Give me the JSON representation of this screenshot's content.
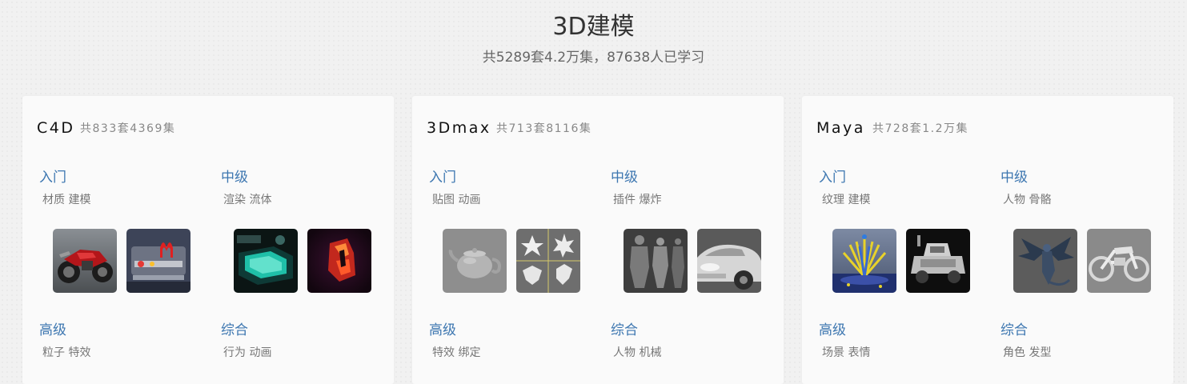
{
  "header": {
    "title": "3D建模",
    "subtitle": "共5289套4.2万集，87638人已学习"
  },
  "cards": [
    {
      "title": "C4D",
      "count": "共833套4369集",
      "levels": [
        {
          "label": "入门",
          "tags": "材质 建模"
        },
        {
          "label": "中级",
          "tags": "渲染 流体"
        },
        {
          "label": "高级",
          "tags": "粒子 特效"
        },
        {
          "label": "综合",
          "tags": "行为 动画"
        }
      ],
      "thumbs": [
        "motorcycle-render-thumbnail",
        "mcdonalds-sign-render-thumbnail",
        "teal-glow-machine-thumbnail",
        "red-crystal-object-thumbnail"
      ]
    },
    {
      "title": "3Dmax",
      "count": "共713套8116集",
      "levels": [
        {
          "label": "入门",
          "tags": "贴图 动画"
        },
        {
          "label": "中级",
          "tags": "插件 爆炸"
        },
        {
          "label": "高级",
          "tags": "特效 绑定"
        },
        {
          "label": "综合",
          "tags": "人物 机械"
        }
      ],
      "thumbs": [
        "teapot-model-thumbnail",
        "lily-flower-viewports-thumbnail",
        "character-sculpt-thumbnail",
        "car-clay-render-thumbnail"
      ]
    },
    {
      "title": "Maya",
      "count": "共728套1.2万集",
      "levels": [
        {
          "label": "入门",
          "tags": "纹理 建模"
        },
        {
          "label": "中级",
          "tags": "人物 骨骼"
        },
        {
          "label": "高级",
          "tags": "场景 表情"
        },
        {
          "label": "综合",
          "tags": "角色 发型"
        }
      ],
      "thumbs": [
        "plant-scene-viewport-thumbnail",
        "cartoon-truck-thumbnail",
        "dragon-model-thumbnail",
        "motorcycle-clay-thumbnail"
      ]
    }
  ],
  "colors": {
    "level_link": "#3c76b0",
    "page_background": "#f1f1f1",
    "card_background": "#fafafa"
  }
}
